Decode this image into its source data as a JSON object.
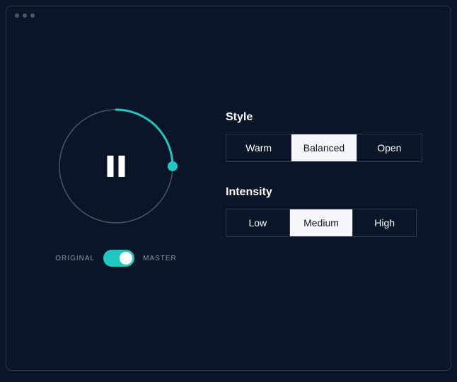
{
  "toggle": {
    "left_label": "ORIGINAL",
    "right_label": "MASTER"
  },
  "style": {
    "title": "Style",
    "options": {
      "warm": "Warm",
      "balanced": "Balanced",
      "open": "Open"
    }
  },
  "intensity": {
    "title": "Intensity",
    "options": {
      "low": "Low",
      "medium": "Medium",
      "high": "High"
    }
  }
}
